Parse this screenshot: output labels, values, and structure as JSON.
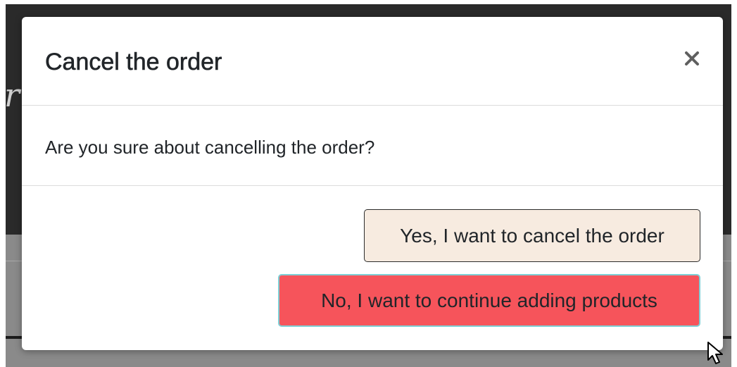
{
  "dialog": {
    "title": "Cancel the order",
    "close_glyph": "×",
    "message": "Are you sure about cancelling the order?",
    "confirm_label": "Yes, I want to cancel the order",
    "dismiss_label": "No, I want to continue adding products"
  },
  "icons": {
    "close": "close-icon",
    "cursor": "mouse-pointer-icon"
  },
  "colors": {
    "confirm_bg": "#f7ebe0",
    "dismiss_bg": "#f6545b",
    "dismiss_border": "#7fd0d6",
    "backdrop_dark": "#2a2a2a",
    "backdrop_gray": "#8a8a8a"
  }
}
